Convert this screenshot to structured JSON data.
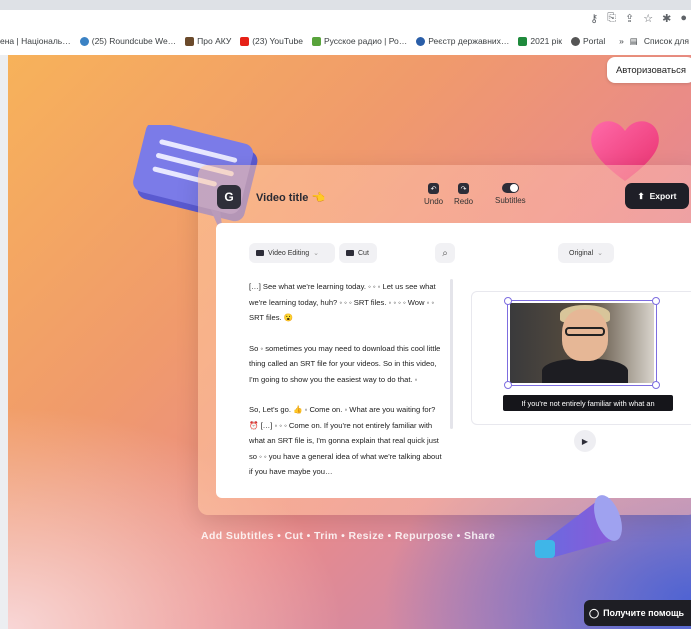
{
  "bookmarks": [
    {
      "label": "ена | Національ…",
      "color": "#e8eaed"
    },
    {
      "label": "(25) Roundcube We…",
      "color": "#3b82c4"
    },
    {
      "label": "Про АКУ",
      "color": "#6b4a2b"
    },
    {
      "label": "(23) YouTube",
      "color": "#e62117"
    },
    {
      "label": "Русское радио | Ро…",
      "color": "#58a33b"
    },
    {
      "label": "Реєстр державних…",
      "color": "#2a5ea8"
    },
    {
      "label": "2021 рік",
      "color": "#1f8a3c"
    },
    {
      "label": "Portal",
      "color": "#555555"
    }
  ],
  "bookmarks_right": {
    "more": "»",
    "reading_list": "Список для"
  },
  "header": {
    "auth_button": "Авторизоваться"
  },
  "editor": {
    "title": "Video title",
    "title_emoji": "👈",
    "toolbar": {
      "undo": "Undo",
      "redo": "Redo",
      "subtitles": "Subtitles"
    },
    "export": "Export",
    "chips": {
      "video_editing": "Video Editing",
      "cut": "Cut",
      "original": "Original"
    },
    "transcript": [
      "[…] See what we're learning today. ◦ ◦ ◦ Let us see what we're learning today, huh? ◦ ◦ ◦ SRT files. ◦ ◦ ◦ ◦ Wow ◦ ◦ SRT files. 😮",
      "So ◦ sometimes you may need to download this cool little thing called an SRT file for your videos. So in this video, I'm going to show you the easiest way to do that. ◦",
      "So, Let's go. 👍 ◦ Come on. ◦ What are you waiting for? ⏰ […] ◦ ◦ ◦ Come on. If you're not entirely familiar with what an SRT file is, I'm gonna explain that real quick just so ◦ ◦ you have a general idea of what we're talking about if you have maybe you…"
    ],
    "caption": "If you're not entirely familiar with what an"
  },
  "features": "Add Subtitles • Cut • Trim • Resize • Repurpose • Share",
  "help_button": "Получите помощь",
  "colors": {
    "accent": "#7d6de0",
    "dark": "#1f1f27"
  }
}
